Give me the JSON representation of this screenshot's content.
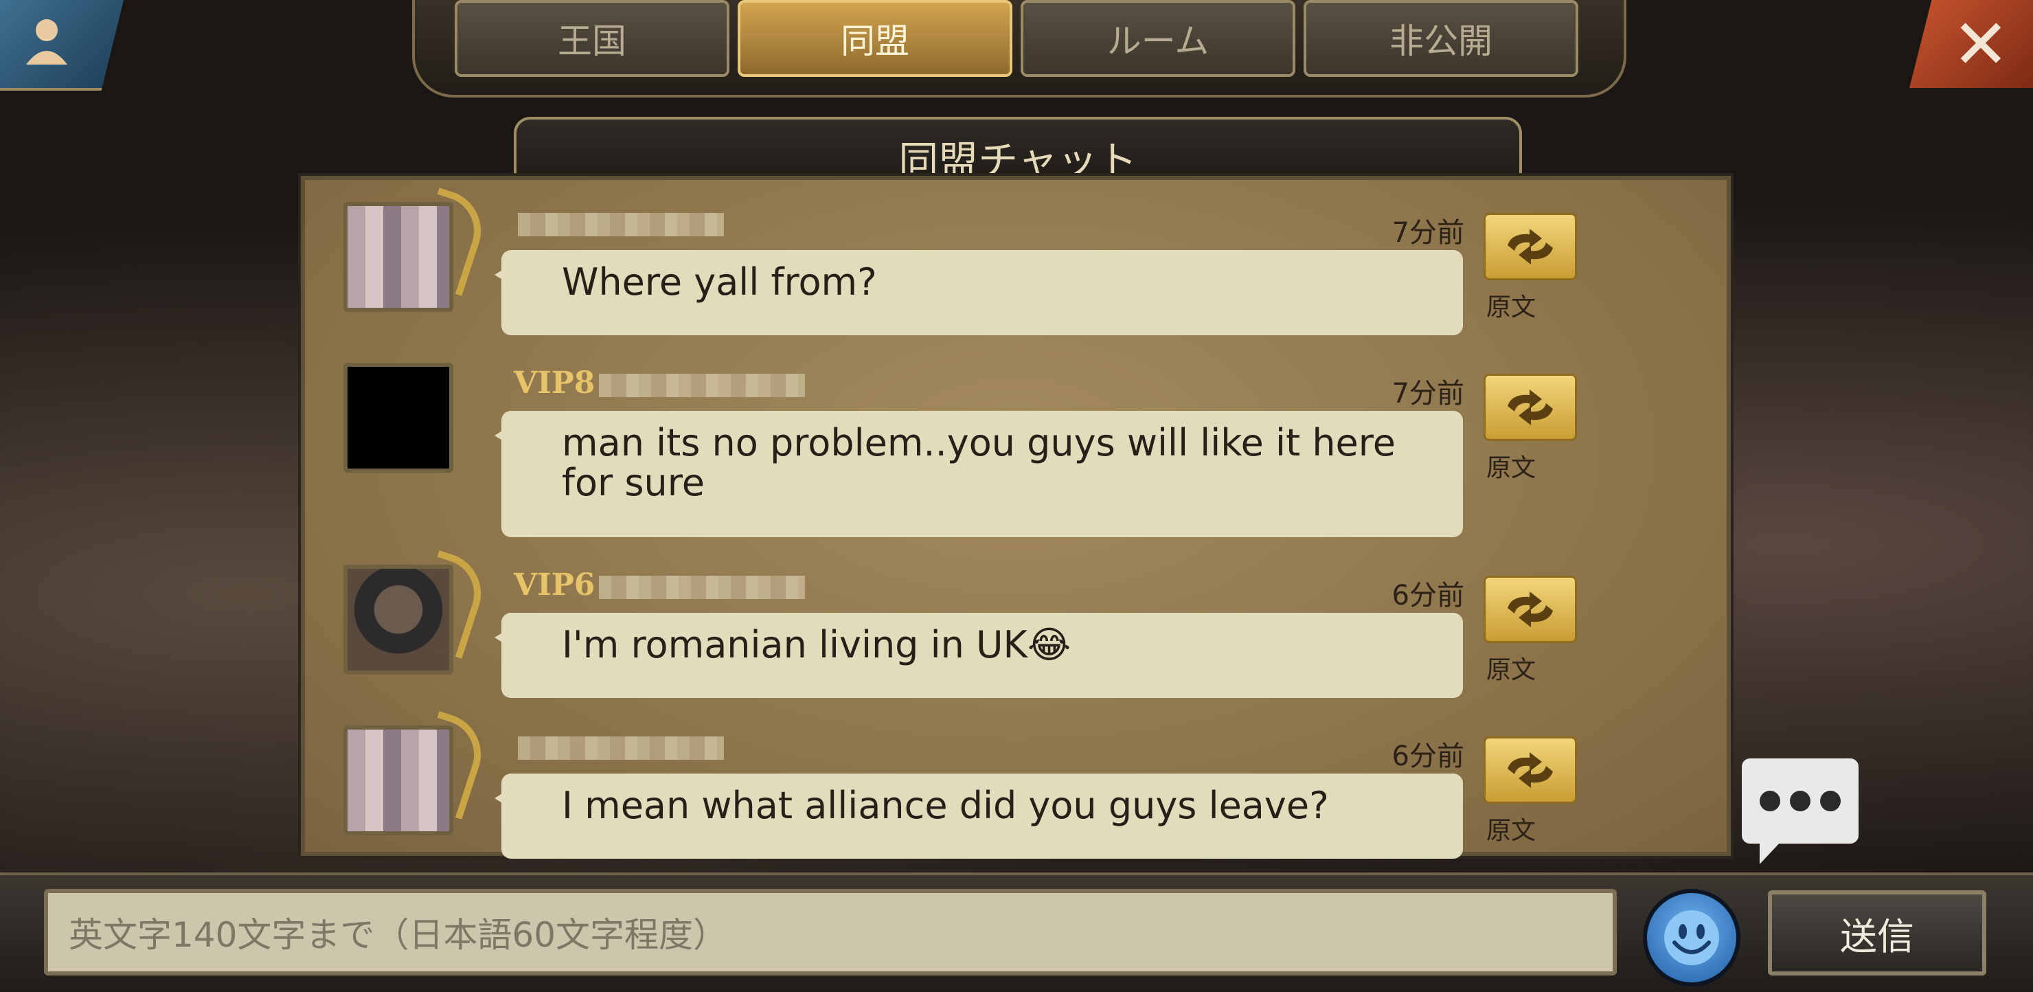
{
  "top": {
    "tabs": [
      {
        "label": "王国",
        "active": false
      },
      {
        "label": "同盟",
        "active": true
      },
      {
        "label": "ルーム",
        "active": false
      },
      {
        "label": "非公開",
        "active": false
      }
    ],
    "close_icon": "close-icon",
    "profile_icon": "user-icon"
  },
  "panel": {
    "title": "同盟チャット"
  },
  "messages": [
    {
      "vip": "",
      "time": "7分前",
      "text": "Where yall from?",
      "original_label": "原文"
    },
    {
      "vip": "VIP8",
      "time": "7分前",
      "text": "man its no problem..you guys will like it here for sure",
      "original_label": "原文"
    },
    {
      "vip": "VIP6",
      "time": "6分前",
      "text": "I'm romanian living in UK😂",
      "original_label": "原文"
    },
    {
      "vip": "",
      "time": "6分前",
      "text": "I mean what alliance did you guys leave?",
      "original_label": "原文"
    }
  ],
  "composer": {
    "placeholder": "英文字140文字まで（日本語60文字程度）",
    "send_label": "送信",
    "emoji_icon": "emoji-icon"
  },
  "colors": {
    "accent_gold": "#d3a450",
    "bubble": "#e3dcbc",
    "close": "#c9552f",
    "profile": "#3f7090"
  }
}
